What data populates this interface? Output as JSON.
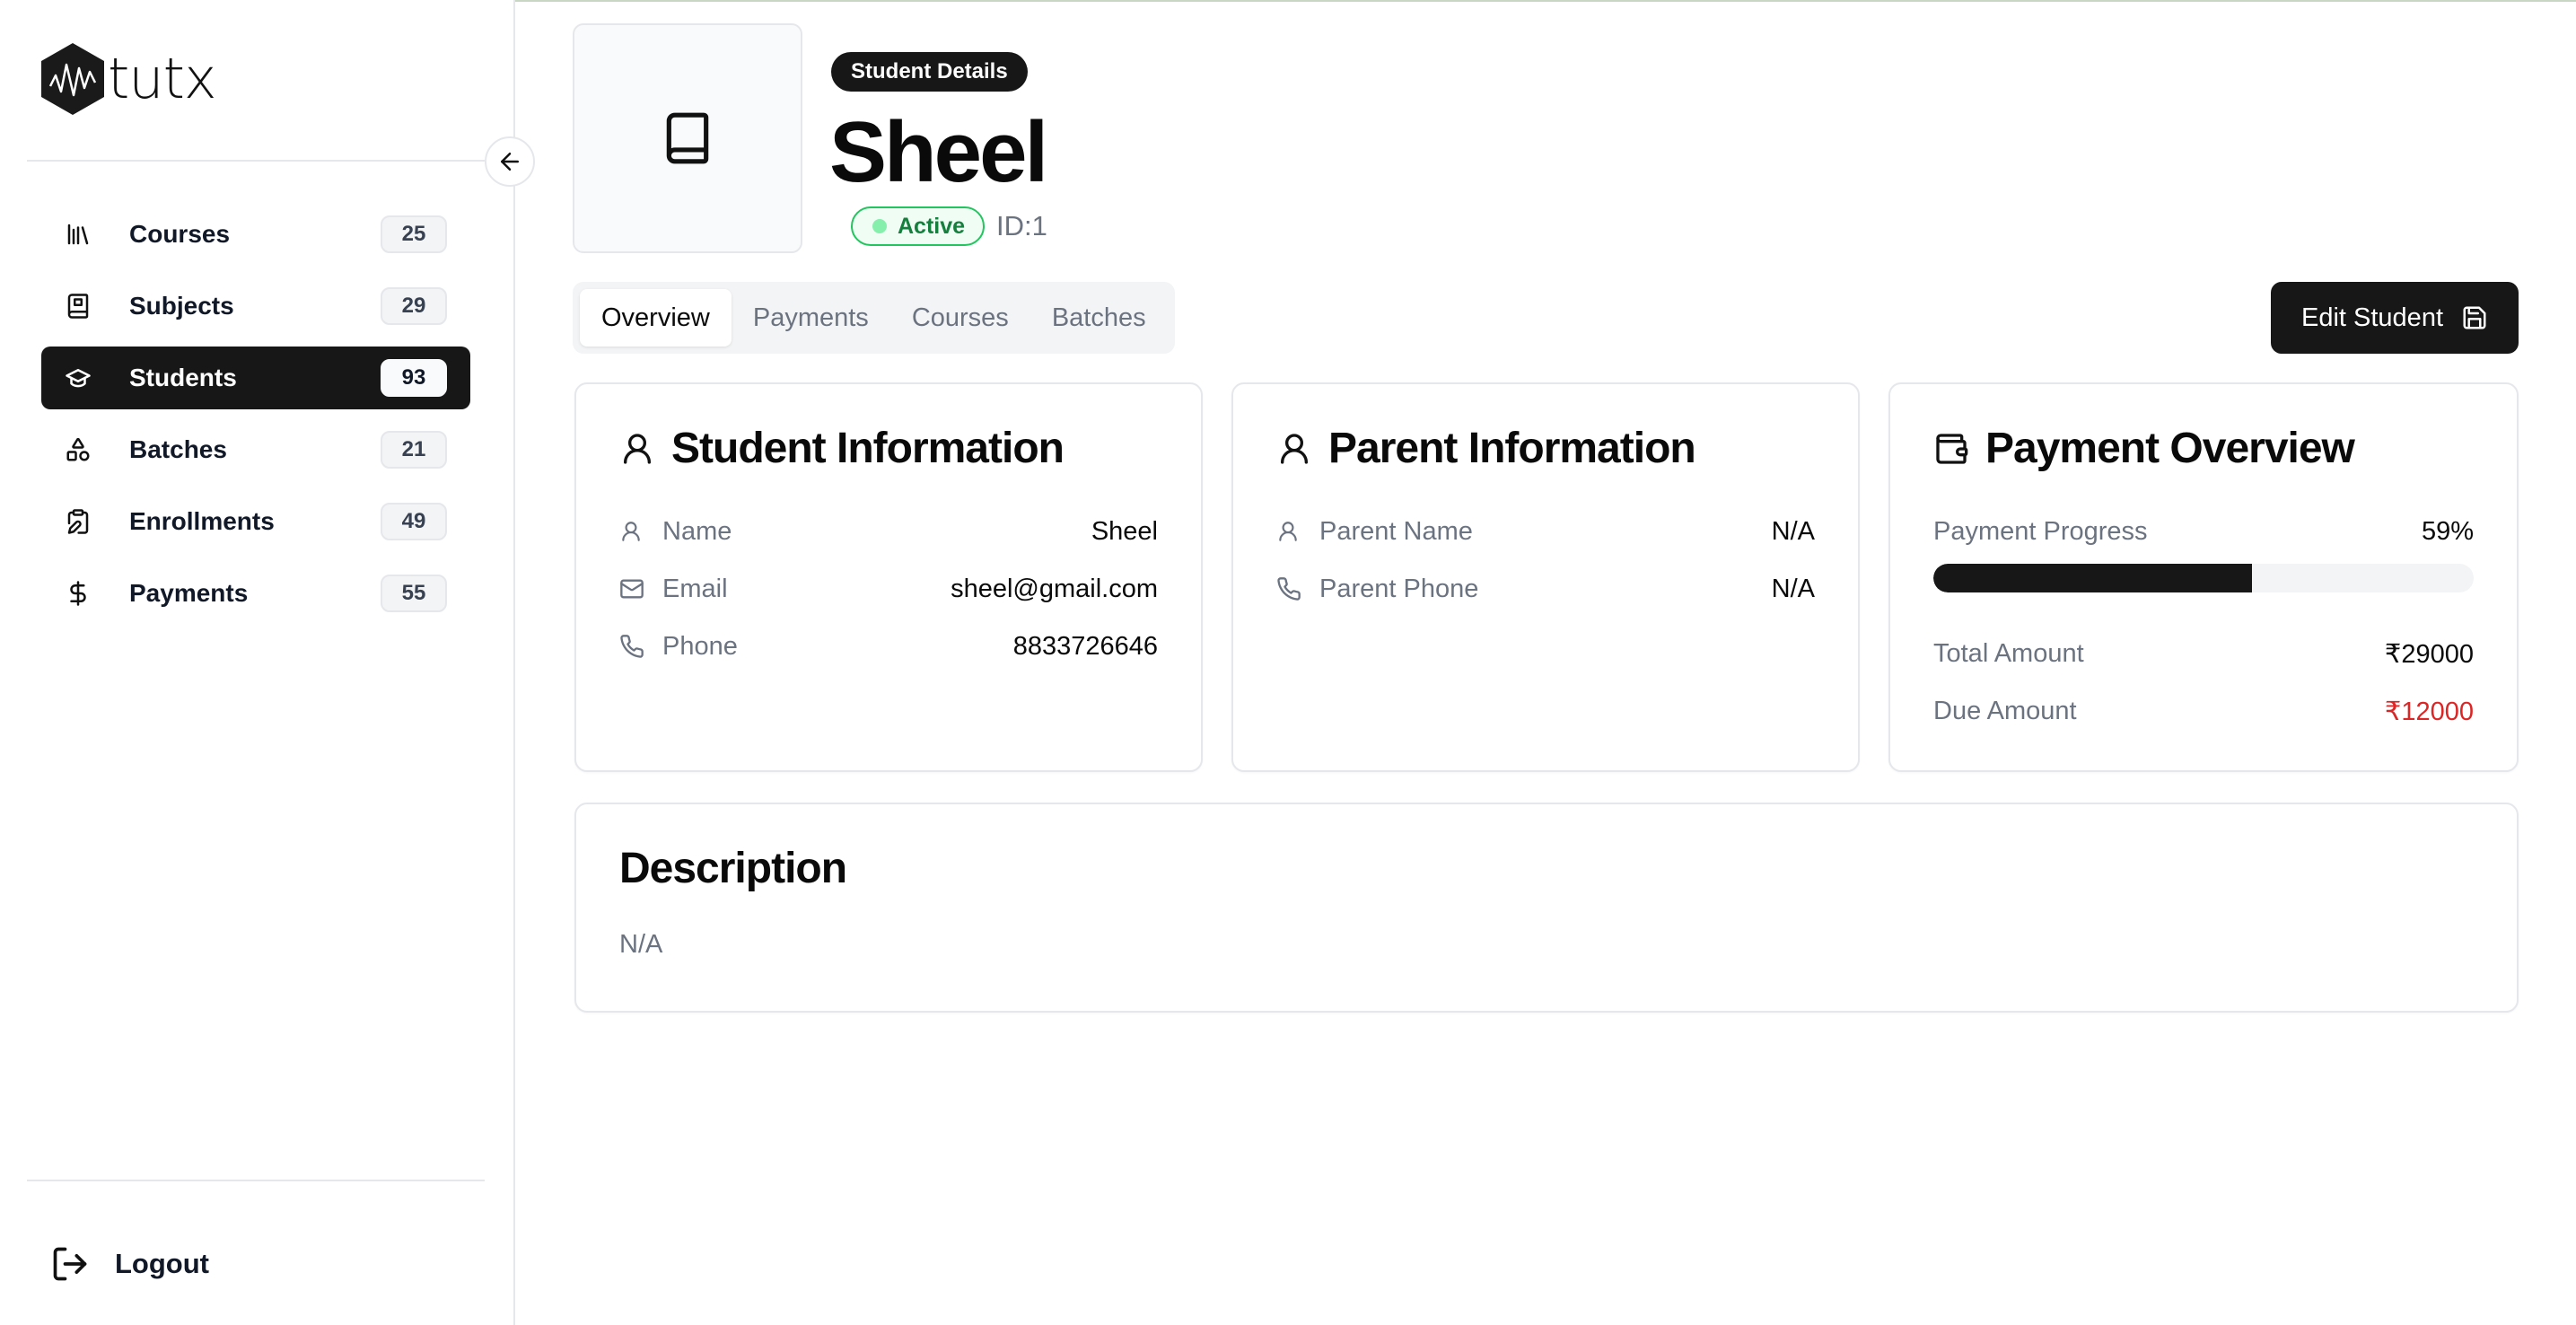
{
  "app": {
    "logo_text": "tutx"
  },
  "sidebar": {
    "items": [
      {
        "label": "Courses",
        "count": "25",
        "icon": "library-icon",
        "active": false
      },
      {
        "label": "Subjects",
        "count": "29",
        "icon": "book-icon",
        "active": false
      },
      {
        "label": "Students",
        "count": "93",
        "icon": "graduation-cap-icon",
        "active": true
      },
      {
        "label": "Batches",
        "count": "21",
        "icon": "shapes-icon",
        "active": false
      },
      {
        "label": "Enrollments",
        "count": "49",
        "icon": "clipboard-edit-icon",
        "active": false
      },
      {
        "label": "Payments",
        "count": "55",
        "icon": "dollar-icon",
        "active": false
      }
    ],
    "logout_label": "Logout"
  },
  "header": {
    "badge": "Student Details",
    "name": "Sheel",
    "status": "Active",
    "id_text": "ID:1"
  },
  "tabs": [
    "Overview",
    "Payments",
    "Courses",
    "Batches"
  ],
  "active_tab": "Overview",
  "edit_button": "Edit Student",
  "student_info": {
    "title": "Student Information",
    "rows": [
      {
        "label": "Name",
        "value": "Sheel",
        "icon": "user-icon"
      },
      {
        "label": "Email",
        "value": "sheel@gmail.com",
        "icon": "mail-icon"
      },
      {
        "label": "Phone",
        "value": "8833726646",
        "icon": "phone-icon"
      }
    ]
  },
  "parent_info": {
    "title": "Parent Information",
    "rows": [
      {
        "label": "Parent Name",
        "value": "N/A",
        "icon": "user-icon"
      },
      {
        "label": "Parent Phone",
        "value": "N/A",
        "icon": "phone-icon"
      }
    ]
  },
  "payment_overview": {
    "title": "Payment Overview",
    "progress_label": "Payment Progress",
    "progress_text": "59%",
    "progress_fraction": 0.59,
    "total_label": "Total Amount",
    "total_value": "₹29000",
    "due_label": "Due Amount",
    "due_value": "₹12000",
    "due_color": "#dc2626"
  },
  "description": {
    "title": "Description",
    "text": "N/A"
  },
  "colors": {
    "accent": "#171717",
    "success": "#16a34a",
    "danger": "#dc2626"
  }
}
